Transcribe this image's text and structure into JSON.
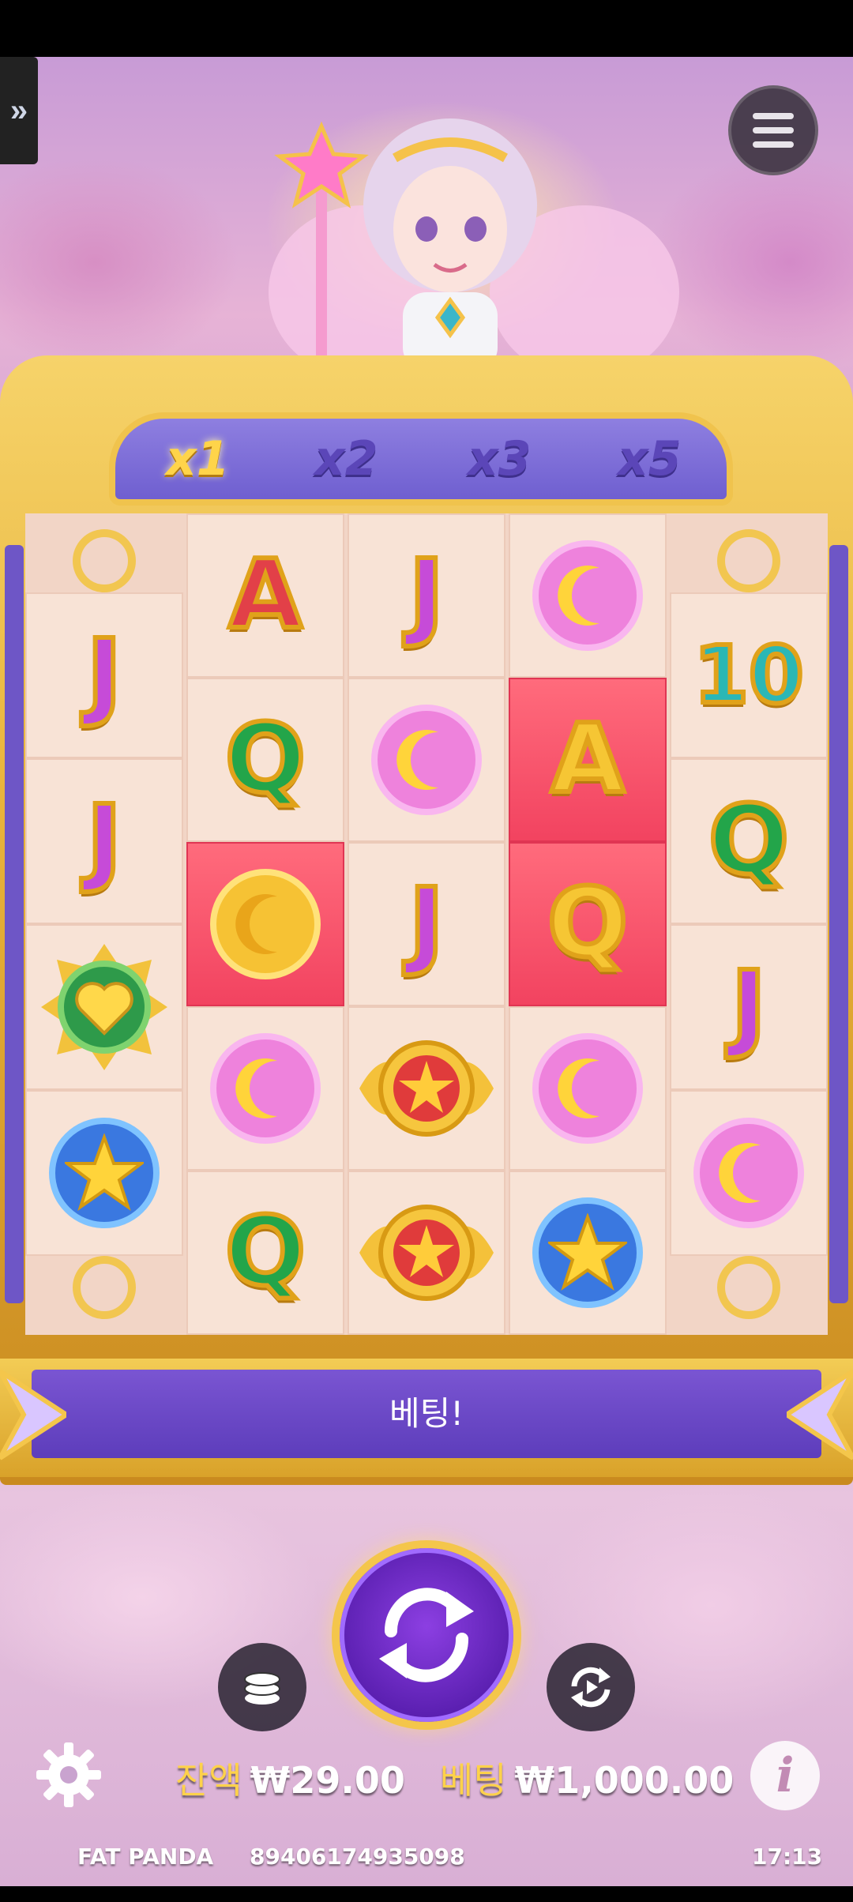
{
  "nav": {
    "side_toggle": "»"
  },
  "multipliers": [
    "x1",
    "x2",
    "x3",
    "x5"
  ],
  "active_multiplier": "x1",
  "grid": {
    "columns": [
      [
        "J",
        "J",
        "heart-gem",
        "star-coin"
      ],
      [
        "A",
        "Q",
        "moon-coin-gold",
        "moon-coin",
        "Q"
      ],
      [
        "J",
        "moon-coin",
        "J",
        "sun-medallion",
        "sun-medallion"
      ],
      [
        "moon-coin",
        "A-gold",
        "Q-gold",
        "moon-coin",
        "star-coin"
      ],
      [
        "10",
        "Q",
        "J",
        "moon-coin"
      ]
    ]
  },
  "banner": {
    "message": "베팅!"
  },
  "wallet": {
    "balance_label": "잔액",
    "balance_value": "₩29.00",
    "bet_label": "베팅",
    "bet_value": "₩1,000.00"
  },
  "footer": {
    "brand": "FAT PANDA",
    "session_id": "89406174935098",
    "time": "17:13"
  },
  "colors": {
    "accent_gold": "#ffd24a",
    "frame_purple": "#6e56c6",
    "highlight_red": "#f24360"
  },
  "icons": {
    "menu": "hamburger-icon",
    "spin": "spin-arrows-icon",
    "coins": "coin-stack-icon",
    "autoplay": "autoplay-icon",
    "settings": "gear-icon",
    "info": "info-icon"
  }
}
